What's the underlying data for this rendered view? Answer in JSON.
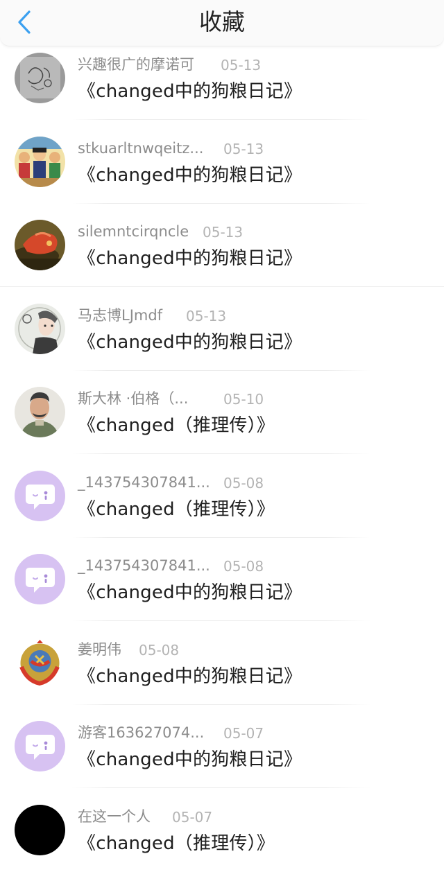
{
  "header": {
    "title": "收藏",
    "back_icon": "chevron-left-icon",
    "accent": "#3ba0f0"
  },
  "items": [
    {
      "user": "兴趣很广的摩诺可",
      "date": "05-13",
      "title": "《changed中的狗粮日记》",
      "avatar": "sketch-avatar"
    },
    {
      "user": "stkuarltnwqeitz...",
      "date": "05-13",
      "title": "《changed中的狗粮日记》",
      "avatar": "cartoon-group-avatar"
    },
    {
      "user": "silemntcirqncle",
      "date": "05-13",
      "title": "《changed中的狗粮日记》",
      "avatar": "red-dragon-avatar"
    },
    {
      "user": "马志博LJmdf",
      "date": "05-13",
      "title": "《changed中的狗粮日记》",
      "avatar": "anime-character-avatar"
    },
    {
      "user": "斯大林 ·伯格（...",
      "date": "05-10",
      "title": "《changed（推理传）》",
      "avatar": "portrait-avatar"
    },
    {
      "user": "_143754307841...",
      "date": "05-08",
      "title": "《changed（推理传）》",
      "avatar": "default-chat-avatar"
    },
    {
      "user": "_143754307841...",
      "date": "05-08",
      "title": "《changed中的狗粮日记》",
      "avatar": "default-chat-avatar"
    },
    {
      "user": "姜明伟",
      "date": "05-08",
      "title": "《changed中的狗粮日记》",
      "avatar": "emblem-avatar"
    },
    {
      "user": "游客163627074...",
      "date": "05-07",
      "title": "《changed中的狗粮日记》",
      "avatar": "default-chat-avatar"
    },
    {
      "user": "在这一个人",
      "date": "05-07",
      "title": "《changed（推理传）》",
      "avatar": "black-avatar"
    }
  ],
  "colors": {
    "default_avatar_bg": "#d7c2f2",
    "name": "#8c8c8c",
    "date": "#b3b3b3"
  }
}
